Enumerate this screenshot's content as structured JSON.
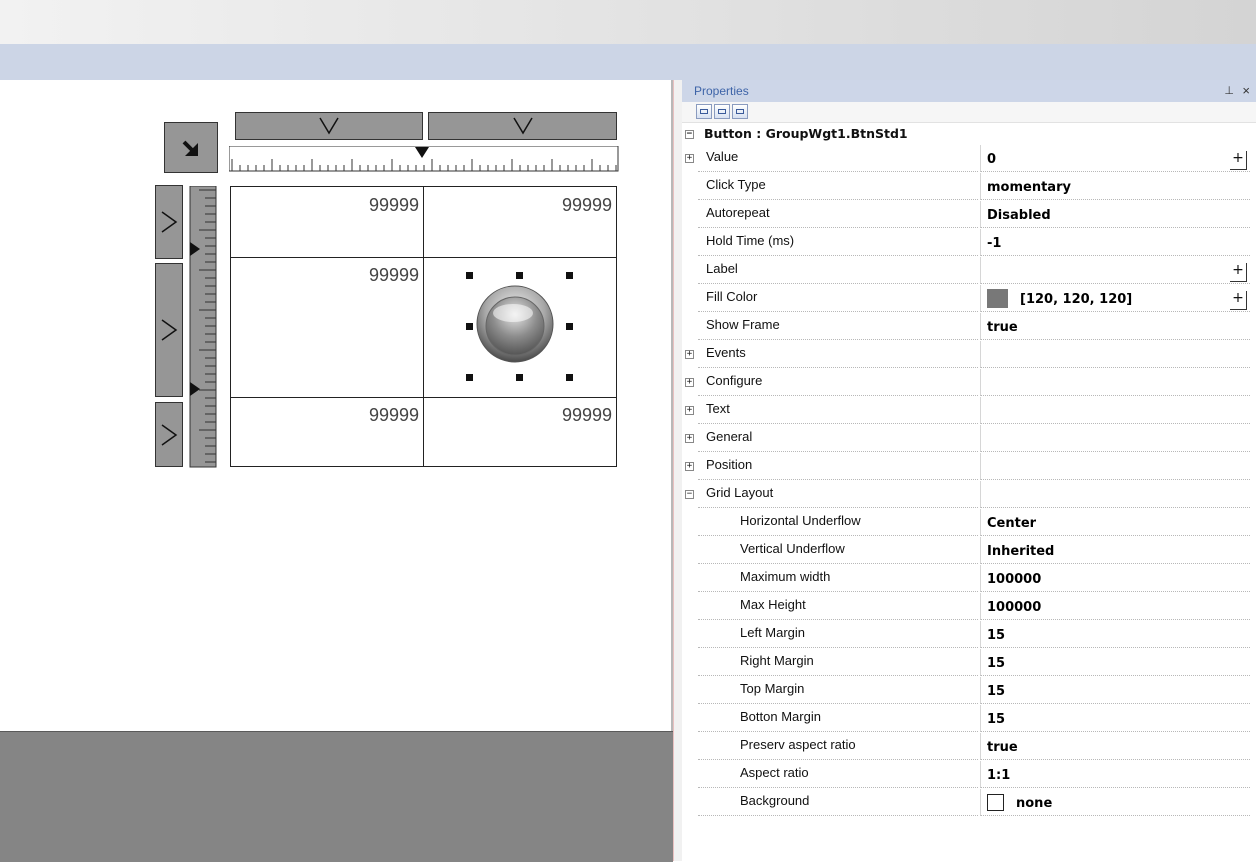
{
  "canvas": {
    "cell_values": [
      "99999",
      "99999",
      "99999",
      "99999",
      "99999"
    ]
  },
  "properties": {
    "title": "Properties",
    "pin_icon": "⊥",
    "close_icon": "×",
    "toolbar_icons": [
      "categorized-icon",
      "alphabetical-icon",
      "property-pages-icon"
    ],
    "header": "Button : GroupWgt1.BtnStd1",
    "rows": [
      {
        "label": "Value",
        "value": "0",
        "expandable": true,
        "plus": true
      },
      {
        "label": "Click Type",
        "value": "momentary"
      },
      {
        "label": "Autorepeat",
        "value": "Disabled"
      },
      {
        "label": "Hold Time (ms)",
        "value": "-1"
      },
      {
        "label": "Label",
        "value": "",
        "plus": true
      },
      {
        "label": "Fill Color",
        "value": "[120, 120, 120]",
        "plus": true,
        "swatch": "#787878"
      },
      {
        "label": "Show Frame",
        "value": "true"
      },
      {
        "label": "Events",
        "value": "",
        "expandable": true
      },
      {
        "label": "Configure",
        "value": "",
        "expandable": true
      },
      {
        "label": "Text",
        "value": "",
        "expandable": true
      },
      {
        "label": "General",
        "value": "",
        "expandable": true
      },
      {
        "label": "Position",
        "value": "",
        "expandable": true
      },
      {
        "label": "Grid Layout",
        "value": "",
        "collapsible": true
      },
      {
        "label": "Horizontal Underflow",
        "value": "Center",
        "sub": true
      },
      {
        "label": "Vertical Underflow",
        "value": "Inherited",
        "sub": true
      },
      {
        "label": "Maximum width",
        "value": "100000",
        "sub": true
      },
      {
        "label": "Max Height",
        "value": "100000",
        "sub": true
      },
      {
        "label": "Left Margin",
        "value": "15",
        "sub": true
      },
      {
        "label": "Right Margin",
        "value": "15",
        "sub": true
      },
      {
        "label": "Top Margin",
        "value": "15",
        "sub": true
      },
      {
        "label": "Botton Margin",
        "value": "15",
        "sub": true
      },
      {
        "label": "Preserv aspect ratio",
        "value": "true",
        "sub": true
      },
      {
        "label": "Aspect ratio",
        "value": "1:1",
        "sub": true
      },
      {
        "label": "Background",
        "value": "none",
        "sub": true,
        "empty_swatch": true
      }
    ]
  },
  "colors": {
    "fill_color": "#787878",
    "panel_title_bg": "#cdd6e8",
    "panel_title_text": "#3e64a8"
  }
}
